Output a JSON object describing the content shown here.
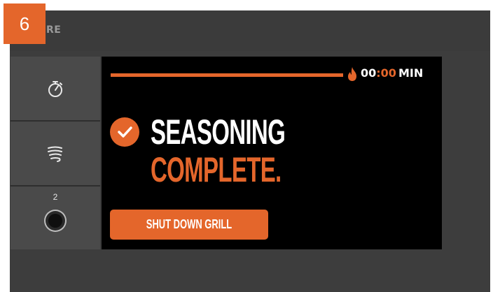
{
  "step": {
    "number": "6"
  },
  "topbar": {
    "partial_title": "RE"
  },
  "sidebar": {
    "items": [
      {
        "icon": "timer-icon"
      },
      {
        "icon": "smoke-icon"
      },
      {
        "icon": "probe-icon",
        "label": "2"
      }
    ]
  },
  "status": {
    "timer_minutes": "00",
    "timer_separator": ":",
    "timer_seconds": "00",
    "timer_unit": "MIN",
    "headline_line1": "SEASONING",
    "headline_line2": "COMPLETE.",
    "action_label": "SHUT DOWN GRILL"
  },
  "colors": {
    "accent": "#e4662b",
    "screen_bg": "#000000",
    "frame_bg": "#3d3d3d",
    "sidebar_bg": "#4a4a4a"
  }
}
